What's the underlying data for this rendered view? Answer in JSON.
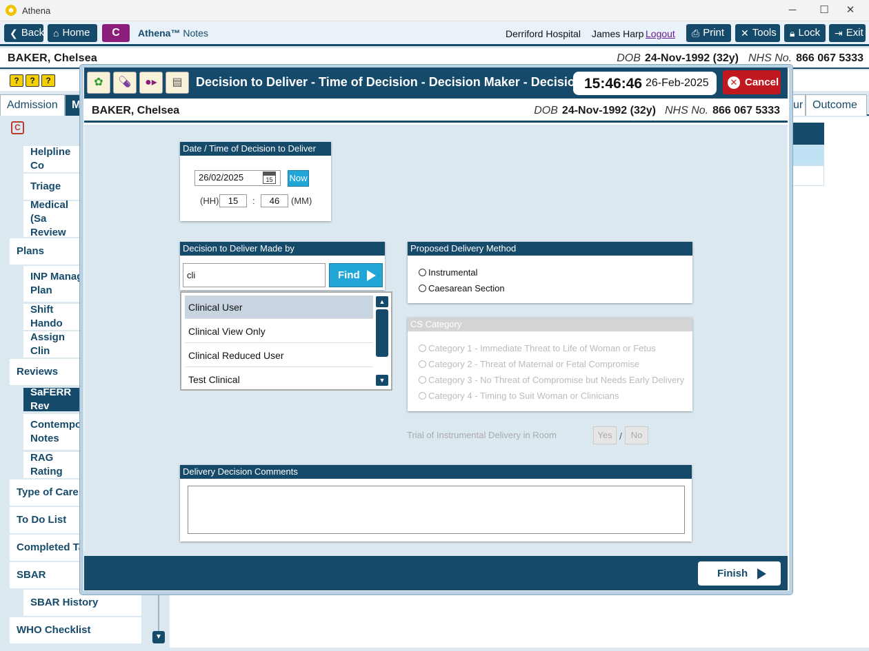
{
  "window": {
    "title": "Athena",
    "app_icon_glyph": "☻",
    "minimize": "─",
    "maximize": "☐",
    "close": "✕"
  },
  "toolbar": {
    "back": "Back",
    "home": "Home",
    "logo_letter": "C",
    "app_name_bold": "Athena™",
    "app_name_rest": " Notes",
    "hospital": "Derriford Hospital",
    "user": "James Harp",
    "logout": "Logout",
    "print": "Print",
    "tools": "Tools",
    "lock": "Lock",
    "exit": "Exit"
  },
  "patient": {
    "name": "BAKER, Chelsea",
    "dob_label": "DOB",
    "dob": "24-Nov-1992 (32y)",
    "nhs_label": "NHS No.",
    "nhs": "866 067 5333"
  },
  "help_icons": [
    "?",
    "?",
    "?"
  ],
  "tabs": {
    "admission": "Admission",
    "active_partial": "M",
    "partial_ur": "ur",
    "outcome": "Outcome"
  },
  "sidebar": {
    "c_icon": "C",
    "items": [
      "Helpline Co",
      "Triage",
      "Medical (Sa",
      "Review",
      "Plans",
      "INP Manag",
      "Plan",
      "Shift Hando",
      "Assign Clin",
      "Reviews",
      "SaFERR Rev",
      "Contempo",
      "Notes",
      "RAG Rating",
      "Type of Care",
      "To Do List",
      "Completed Ta",
      "SBAR",
      "SBAR History",
      "WHO Checklist"
    ]
  },
  "modal": {
    "title": "Decision to Deliver - Time of Decision - Decision Maker - Decision Details",
    "time": "15:46:46",
    "date": "26-Feb-2025",
    "cancel": "Cancel",
    "date_panel": {
      "header": "Date / Time of Decision to Deliver",
      "date_value": "26/02/2025",
      "calendar_day": "15",
      "now": "Now",
      "hh_label": "(HH)",
      "hh": "15",
      "colon": ":",
      "mm": "46",
      "mm_label": "(MM)"
    },
    "maker_panel": {
      "header": "Decision to Deliver Made by",
      "search_value": "cli",
      "find": "Find",
      "results": [
        "Clinical User",
        "Clinical View Only",
        "Clinical Reduced User",
        "Test Clinical"
      ]
    },
    "method_panel": {
      "header": "Proposed Delivery Method",
      "options": [
        "Instrumental",
        "Caesarean Section"
      ]
    },
    "cs_panel": {
      "header": "CS Category",
      "options": [
        "Category 1 - Immediate Threat to Life of Woman or Fetus",
        "Category 2 - Threat of Maternal or Fetal Compromise",
        "Category 3 - No Threat of Compromise but Needs Early Delivery",
        "Category 4 - Timing to Suit Woman or Clinicians"
      ]
    },
    "trial": {
      "label": "Trial of Instrumental Delivery in Room",
      "yes": "Yes",
      "slash": "/",
      "no": "No"
    },
    "comments_panel": {
      "header": "Delivery Decision Comments",
      "value": ""
    },
    "finish": "Finish"
  },
  "colors": {
    "primary": "#164a6b",
    "accent": "#22a6d8",
    "danger": "#c0181e",
    "brand": "#8c1d7a"
  }
}
